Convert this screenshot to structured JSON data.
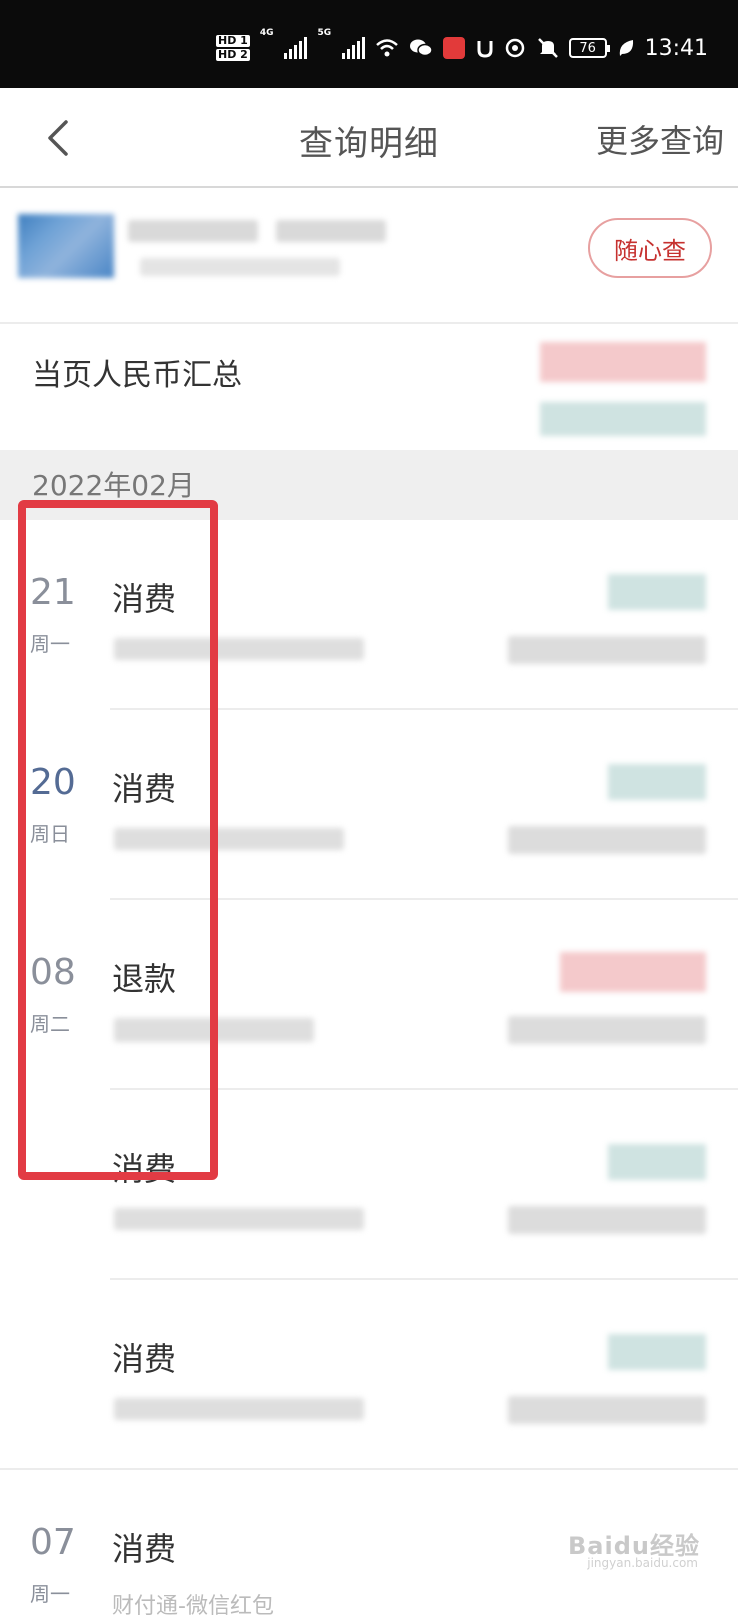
{
  "status_bar": {
    "hd1": "HD 1",
    "hd2": "HD 2",
    "net1": "4G",
    "net2": "5G",
    "battery": "76",
    "time": "13:41",
    "icons": [
      "wifi-icon",
      "wechat-icon",
      "app-badge-icon",
      "alarm-icon",
      "nfc-icon",
      "mute-icon",
      "leaf-icon"
    ]
  },
  "nav": {
    "title": "查询明细",
    "more": "更多查询"
  },
  "account": {
    "action": "随心查"
  },
  "summary": {
    "label": "当页人民币汇总"
  },
  "month": "2022年02月",
  "transactions": [
    {
      "day": "21",
      "week": "周一",
      "type": "消费",
      "desc": ""
    },
    {
      "day": "20",
      "week": "周日",
      "type": "消费",
      "desc": ""
    },
    {
      "day": "08",
      "week": "周二",
      "type": "退款",
      "desc": ""
    },
    {
      "day": "",
      "week": "",
      "type": "消费",
      "desc": ""
    },
    {
      "day": "",
      "week": "",
      "type": "消费",
      "desc": ""
    },
    {
      "day": "07",
      "week": "周一",
      "type": "消费",
      "desc": "财付通-微信红包"
    }
  ],
  "watermark": {
    "main": "Baidu经验",
    "sub": "jingyan.baidu.com"
  },
  "colors": {
    "accent_red": "#c6312f",
    "highlight_red": "#e23b44",
    "date_blue": "#546b94"
  }
}
